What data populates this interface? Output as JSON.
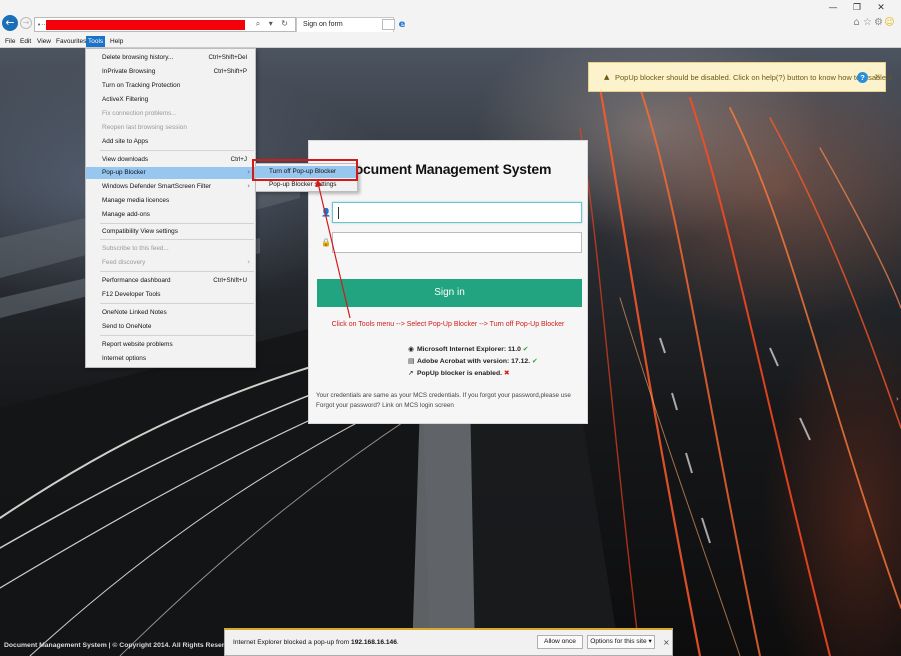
{
  "browser": {
    "back_icon": "←",
    "fwd_icon": "→",
    "address_icons": "⌕ ▾ ↻",
    "tab_title": "Sign on form",
    "tab_close": "×",
    "window_buttons": [
      "—",
      "❐",
      "✕"
    ],
    "tool_icons": [
      "⌂",
      "☆",
      "⚙",
      "☺"
    ],
    "menubar": [
      "File",
      "Edit",
      "View",
      "Favourites",
      "Tools",
      "Help"
    ],
    "menubar_active": "Tools"
  },
  "tools_menu": {
    "items": [
      {
        "label": "Delete browsing history...",
        "shortcut": "Ctrl+Shift+Del"
      },
      {
        "label": "InPrivate Browsing",
        "shortcut": "Ctrl+Shift+P"
      },
      {
        "label": "Turn on Tracking Protection",
        "shortcut": ""
      },
      {
        "label": "ActiveX Filtering",
        "shortcut": ""
      },
      {
        "label": "Fix connection problems...",
        "shortcut": "",
        "disabled": true
      },
      {
        "label": "Reopen last browsing session",
        "shortcut": "",
        "disabled": true
      },
      {
        "label": "Add site to Apps",
        "shortcut": ""
      },
      {
        "label": "View downloads",
        "shortcut": "Ctrl+J"
      },
      {
        "label": "Pop-up Blocker",
        "shortcut": "",
        "submenu": true,
        "highlighted": true
      },
      {
        "label": "Windows Defender SmartScreen Filter",
        "shortcut": "",
        "submenu": true
      },
      {
        "label": "Manage media licences",
        "shortcut": ""
      },
      {
        "label": "Manage add-ons",
        "shortcut": ""
      },
      {
        "label": "Compatibility View settings",
        "shortcut": ""
      },
      {
        "label": "Subscribe to this feed...",
        "shortcut": "",
        "disabled": true
      },
      {
        "label": "Feed discovery",
        "shortcut": "",
        "disabled": true,
        "submenu": true
      },
      {
        "label": "Performance dashboard",
        "shortcut": "Ctrl+Shift+U"
      },
      {
        "label": "F12 Developer Tools",
        "shortcut": ""
      },
      {
        "label": "OneNote Linked Notes",
        "shortcut": ""
      },
      {
        "label": "Send to OneNote",
        "shortcut": ""
      },
      {
        "label": "Report website problems",
        "shortcut": ""
      },
      {
        "label": "Internet options",
        "shortcut": ""
      }
    ],
    "submenu_arrow": "›"
  },
  "popup_submenu": {
    "items": [
      "Turn off Pop-up Blocker",
      "Pop-up Blocker settings"
    ]
  },
  "notice": {
    "warn_icon": "▲",
    "text": "PopUp blocker should be disabled. Click on help(?) button to know how to disable it",
    "help_label": "?",
    "close": "×"
  },
  "login": {
    "title": "Document Management System",
    "user_icon": "👤",
    "lock_icon": "🔒",
    "username_value": "",
    "password_value": "",
    "signin_label": "Sign in",
    "annotation": "Click on Tools menu --> Select Pop-Up Blocker --> Turn off Pop-Up Blocker",
    "checks": [
      {
        "icon": "◉",
        "text": "Microsoft Internet Explorer: 11.0",
        "status": "✔",
        "ok": true
      },
      {
        "icon": "▤",
        "text": "Adobe Acrobat with version: 17.12.",
        "status": "✔",
        "ok": true
      },
      {
        "icon": "↗",
        "text": "PopUp blocker is enabled.",
        "status": "✖",
        "ok": false
      }
    ],
    "credentials_note": "Your credentials are same as your MCS credentials. If you forgot your password,please use Forgot your password? Link on MCS login screen"
  },
  "footer": {
    "text": "Document Management System | © Copyright 2014. All Rights Reserved"
  },
  "notification_bar": {
    "prefix": "Internet Explorer blocked a pop-up from ",
    "host": "192.168.16.146",
    "suffix": ".",
    "allow_label": "Allow once",
    "options_label": "Options for this site ▾",
    "close": "×"
  }
}
